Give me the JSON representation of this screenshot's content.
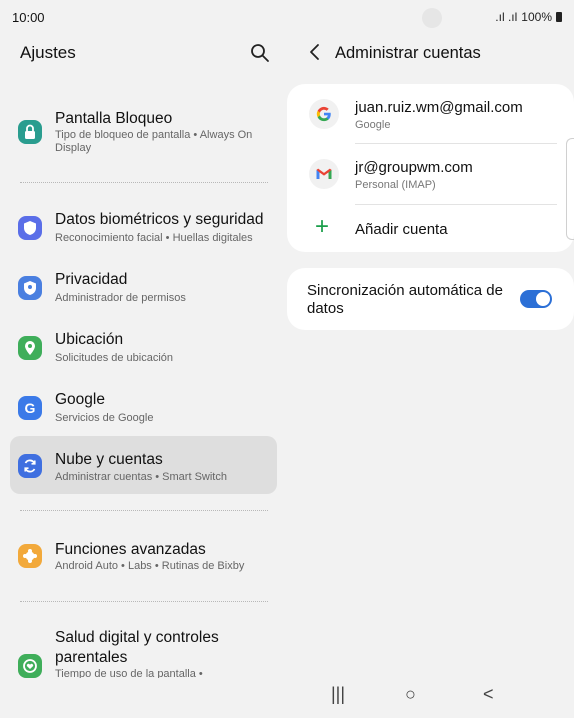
{
  "status": {
    "time": "10:00",
    "signal": ".ıl .ıl",
    "battery": "100%"
  },
  "left": {
    "title": "Ajustes",
    "items": [
      {
        "title": "Pantalla Bloqueo",
        "subtitle": "Tipo de bloqueo de pantalla  •  Always On Display",
        "color": "#2a9d8f",
        "icon": "lock-icon"
      },
      {
        "title": "Datos biométricos y seguridad",
        "subtitle": "Reconocimiento facial  •  Huellas digitales",
        "color": "#5a6ee8",
        "icon": "shield-icon"
      },
      {
        "title": "Privacidad",
        "subtitle": "Administrador de permisos",
        "color": "#4a7fe0",
        "icon": "privacy-icon"
      },
      {
        "title": "Ubicación",
        "subtitle": "Solicitudes de ubicación",
        "color": "#3fae5a",
        "icon": "location-icon"
      },
      {
        "title": "Google",
        "subtitle": "Servicios de Google",
        "color": "#3b7ae8",
        "icon": "google-icon"
      },
      {
        "title": "Nube y cuentas",
        "subtitle": "Administrar cuentas  •  Smart Switch",
        "color": "#3f6fe0",
        "icon": "sync-icon"
      },
      {
        "title": "Funciones avanzadas",
        "subtitle": "Android Auto  •  Labs  •  Rutinas de Bixby",
        "color": "#f2a93b",
        "icon": "puzzle-icon"
      },
      {
        "title": "Salud digital y controles parentales",
        "subtitle": "Tiempo de uso de la pantalla  •",
        "color": "#3fae5a",
        "icon": "wellbeing-icon"
      }
    ]
  },
  "right": {
    "title": "Administrar cuentas",
    "accounts": [
      {
        "name": "juan.ruiz.wm@gmail.com",
        "type": "Google",
        "icon": "google-logo-icon"
      },
      {
        "name": "jr@groupwm.com",
        "type": "Personal (IMAP)",
        "icon": "gmail-icon"
      }
    ],
    "add_account": "Añadir cuenta",
    "sync_label": "Sincronización automática de datos",
    "sync_on": true
  },
  "nav": {
    "recent": "|||",
    "home": "○",
    "back": "<"
  }
}
